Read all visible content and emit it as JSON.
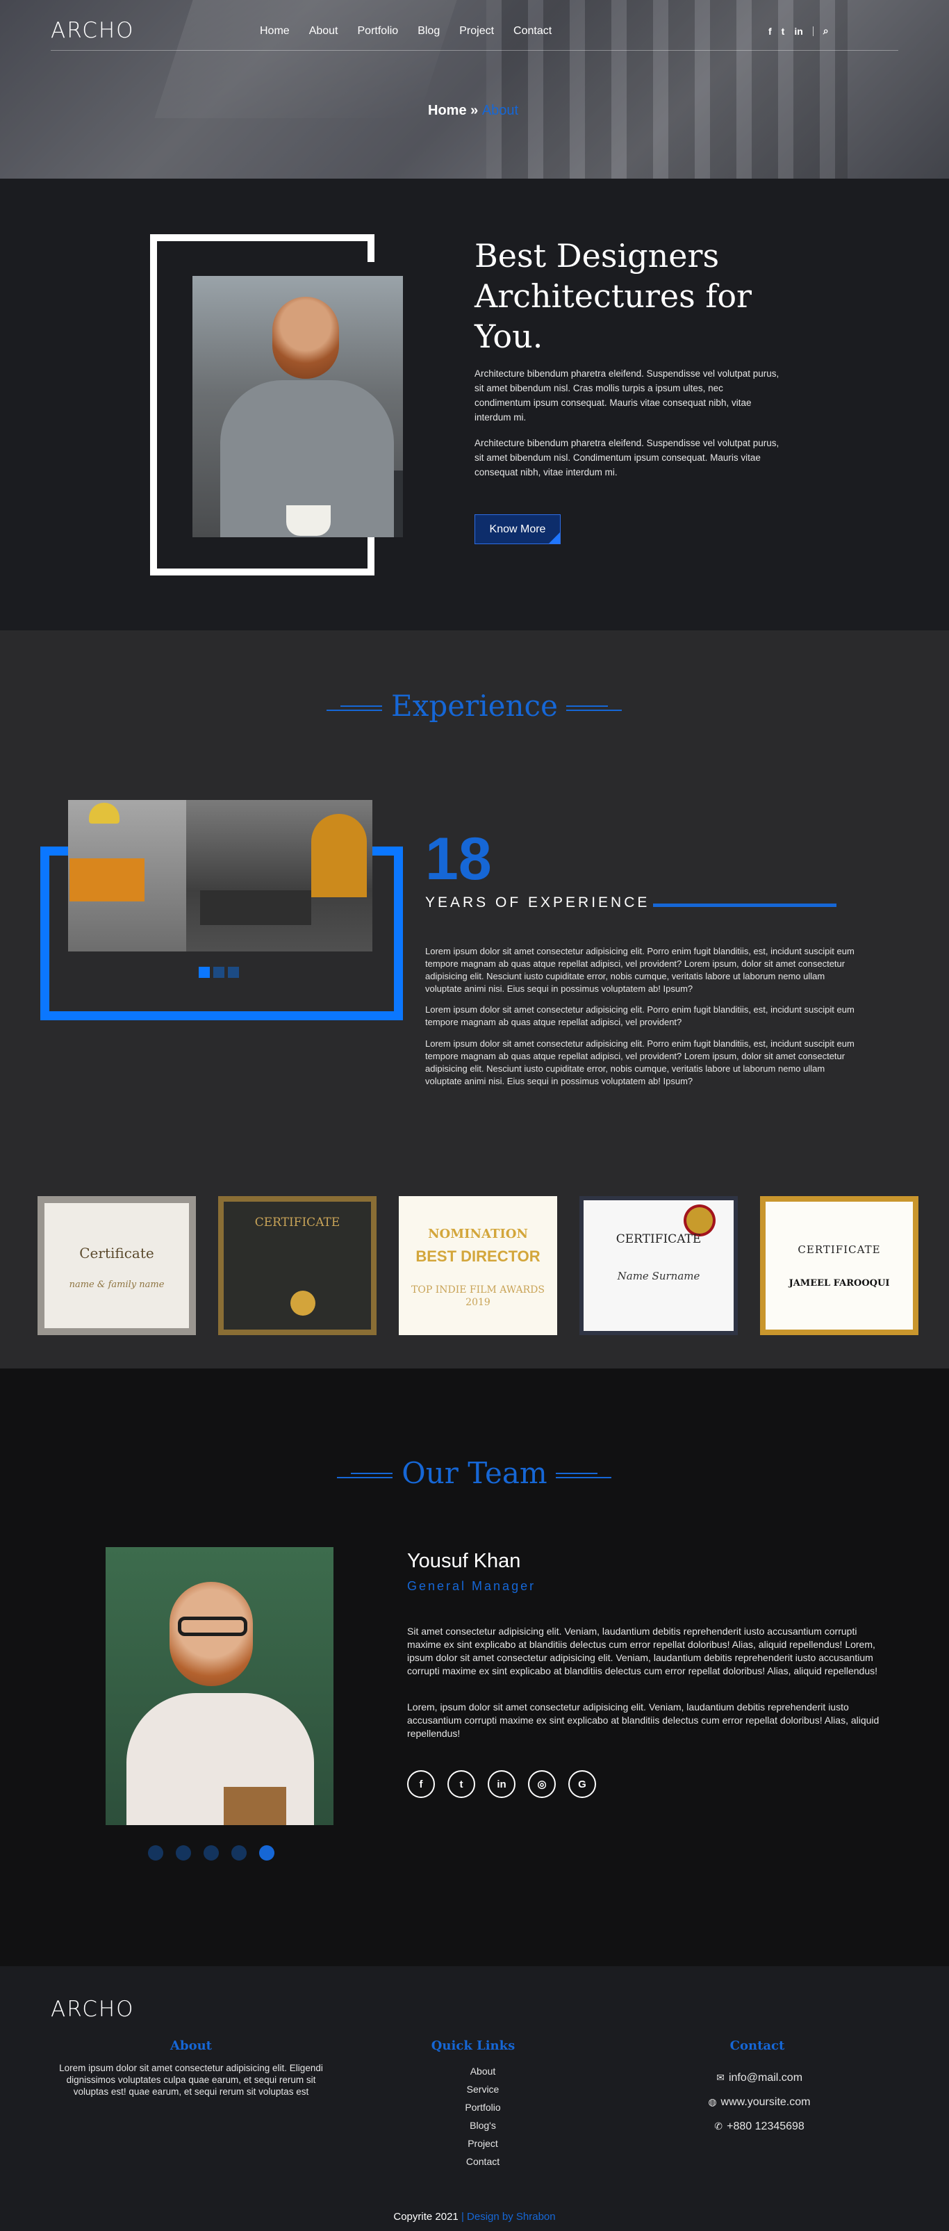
{
  "header": {
    "logo": "ARCHO",
    "nav": [
      "Home",
      "About",
      "Portfolio",
      "Blog",
      "Project",
      "Contact"
    ],
    "social_icons": [
      "facebook-icon",
      "twitter-icon",
      "linkedin-icon"
    ],
    "social_glyphs": [
      "f",
      "t",
      "in"
    ],
    "search_icon": "search-icon",
    "search_glyph": "⌕",
    "breadcrumb": {
      "home": "Home",
      "sep": "»",
      "current": "About"
    }
  },
  "about": {
    "title": "Best Designers Architectures for You.",
    "p1": "Architecture bibendum pharetra eleifend. Suspendisse vel volutpat purus, sit amet bibendum nisl. Cras mollis turpis a ipsum ultes, nec condimentum ipsum consequat. Mauris vitae consequat nibh, vitae interdum mi.",
    "p2": "Architecture bibendum pharetra eleifend. Suspendisse vel volutpat purus, sit amet bibendum nisl. Condimentum ipsum consequat. Mauris vitae consequat nibh, vitae interdum mi.",
    "button": "Know More"
  },
  "experience": {
    "title": "Experience",
    "number": "18",
    "label": "YEARS OF EXPERIENCE",
    "p1": "Lorem ipsum dolor sit amet consectetur adipisicing elit. Porro enim fugit blanditiis, est, incidunt suscipit eum tempore magnam ab quas atque repellat adipisci, vel provident? Lorem ipsum, dolor sit amet consectetur adipisicing elit. Nesciunt iusto cupiditate error, nobis cumque, veritatis labore ut laborum nemo ullam voluptate animi nisi. Eius sequi in possimus voluptatem ab! Ipsum?",
    "p2": "Lorem ipsum dolor sit amet consectetur adipisicing elit. Porro enim fugit blanditiis, est, incidunt suscipit eum tempore magnam ab quas atque repellat adipisci, vel provident?",
    "p3": "Lorem ipsum dolor sit amet consectetur adipisicing elit. Porro enim fugit blanditiis, est, incidunt suscipit eum tempore magnam ab quas atque repellat adipisci, vel provident? Lorem ipsum, dolor sit amet consectetur adipisicing elit. Nesciunt iusto cupiditate error, nobis cumque, veritatis labore ut laborum nemo ullam voluptate animi nisi. Eius sequi in possimus voluptatem ab! Ipsum?",
    "slider_active": 0
  },
  "certificates": {
    "c1": {
      "title": "Certificate",
      "name": "name & family name"
    },
    "c2": {
      "title": "CERTIFICATE"
    },
    "c3": {
      "line1": "NOMINATION",
      "line2": "BEST DIRECTOR",
      "line3": "TOP INDIE FILM AWARDS 2019"
    },
    "c4": {
      "title": "CERTIFICATE",
      "name": "Name Surname"
    },
    "c5": {
      "title": "CERTIFICATE",
      "name": "JAMEEL FAROOQUI"
    }
  },
  "team": {
    "title": "Our Team",
    "name": "Yousuf Khan",
    "role": "General Manager",
    "p1": "Sit amet consectetur adipisicing elit. Veniam, laudantium debitis reprehenderit iusto accusantium corrupti maxime ex sint explicabo at blanditiis delectus cum error repellat doloribus! Alias, aliquid repellendus! Lorem, ipsum dolor sit amet consectetur adipisicing elit. Veniam, laudantium debitis reprehenderit iusto accusantium corrupti maxime ex sint explicabo at blanditiis delectus cum error repellat doloribus! Alias, aliquid repellendus!",
    "p2": "Lorem, ipsum dolor sit amet consectetur adipisicing elit. Veniam, laudantium debitis reprehenderit iusto accusantium corrupti maxime ex sint explicabo at blanditiis delectus cum error repellat doloribus! Alias, aliquid repellendus!",
    "socials": [
      "f",
      "t",
      "in",
      "◎",
      "G"
    ],
    "social_icons": [
      "facebook-icon",
      "twitter-icon",
      "linkedin-icon",
      "instagram-icon",
      "google-icon"
    ],
    "slider_active": 4
  },
  "footer": {
    "logo": "ARCHO",
    "about_title": "About",
    "about_text": "Lorem ipsum dolor sit amet consectetur adipisicing elit. Eligendi dignissimos voluptates culpa quae earum, et sequi rerum sit voluptas est! quae earum, et sequi rerum sit voluptas est",
    "links_title": "Quick Links",
    "links": [
      "About",
      "Service",
      "Portfolio",
      "Blog's",
      "Project",
      "Contact"
    ],
    "contact_title": "Contact",
    "email": "info@mail.com",
    "website": "www.yoursite.com",
    "phone": "+880 12345698",
    "copyright": "Copyrite 2021",
    "copyright_sep": "|",
    "design_by": "Design by Shrabon"
  },
  "colors": {
    "accent": "#1667d6",
    "bright_blue": "#0b77ff",
    "dark_bg": "#1b1c20",
    "mid_bg": "#2a2a2c",
    "team_bg": "#111112"
  }
}
